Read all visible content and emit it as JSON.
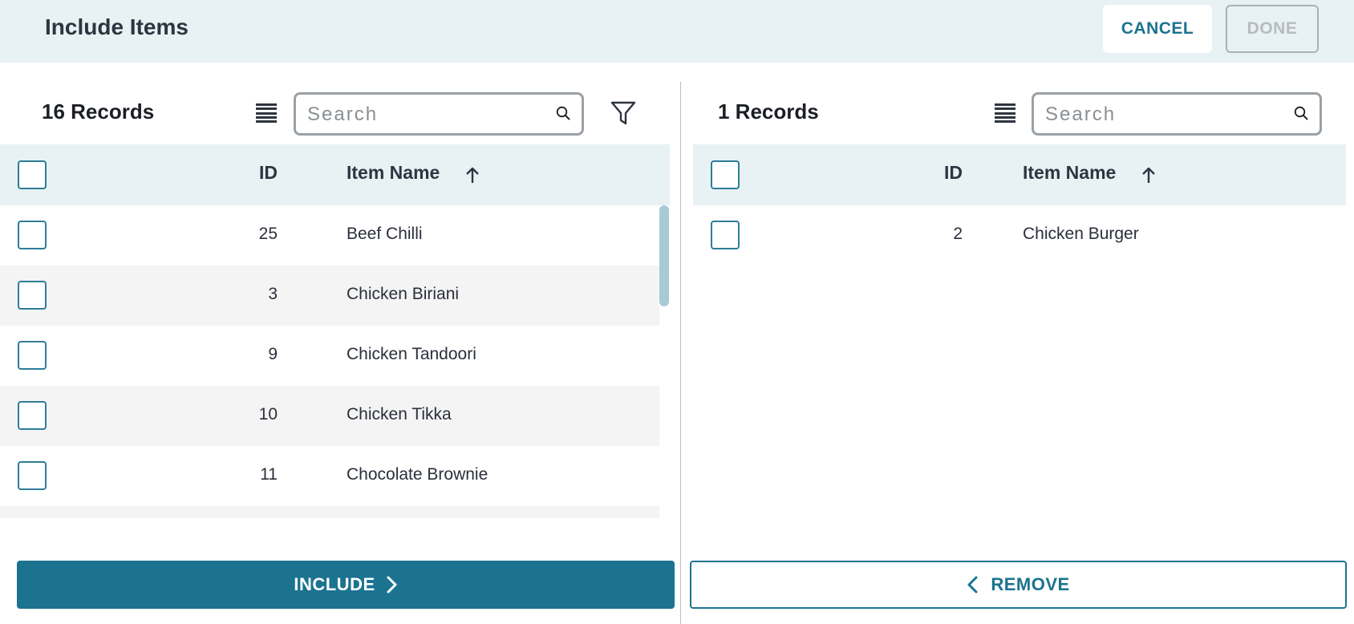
{
  "header": {
    "title": "Include Items",
    "cancel_label": "CANCEL",
    "done_label": "DONE"
  },
  "left": {
    "records_label": "16 Records",
    "search_placeholder": "Search",
    "columns": {
      "id": "ID",
      "name": "Item Name"
    },
    "rows": [
      {
        "id": "25",
        "name": "Beef Chilli"
      },
      {
        "id": "3",
        "name": "Chicken Biriani"
      },
      {
        "id": "9",
        "name": "Chicken Tandoori"
      },
      {
        "id": "10",
        "name": "Chicken Tikka"
      },
      {
        "id": "11",
        "name": "Chocolate Brownie"
      }
    ],
    "action_label": "INCLUDE"
  },
  "right": {
    "records_label": "1 Records",
    "search_placeholder": "Search",
    "columns": {
      "id": "ID",
      "name": "Item Name"
    },
    "rows": [
      {
        "id": "2",
        "name": "Chicken Burger"
      }
    ],
    "action_label": "REMOVE"
  },
  "colors": {
    "accent": "#1b7390",
    "header_bg": "#e8f1f4",
    "row_alt": "#f4f4f4"
  },
  "icons": [
    "list-view-icon",
    "search-icon",
    "filter-icon",
    "sort-ascending-icon",
    "chevron-right-icon",
    "chevron-left-icon"
  ]
}
